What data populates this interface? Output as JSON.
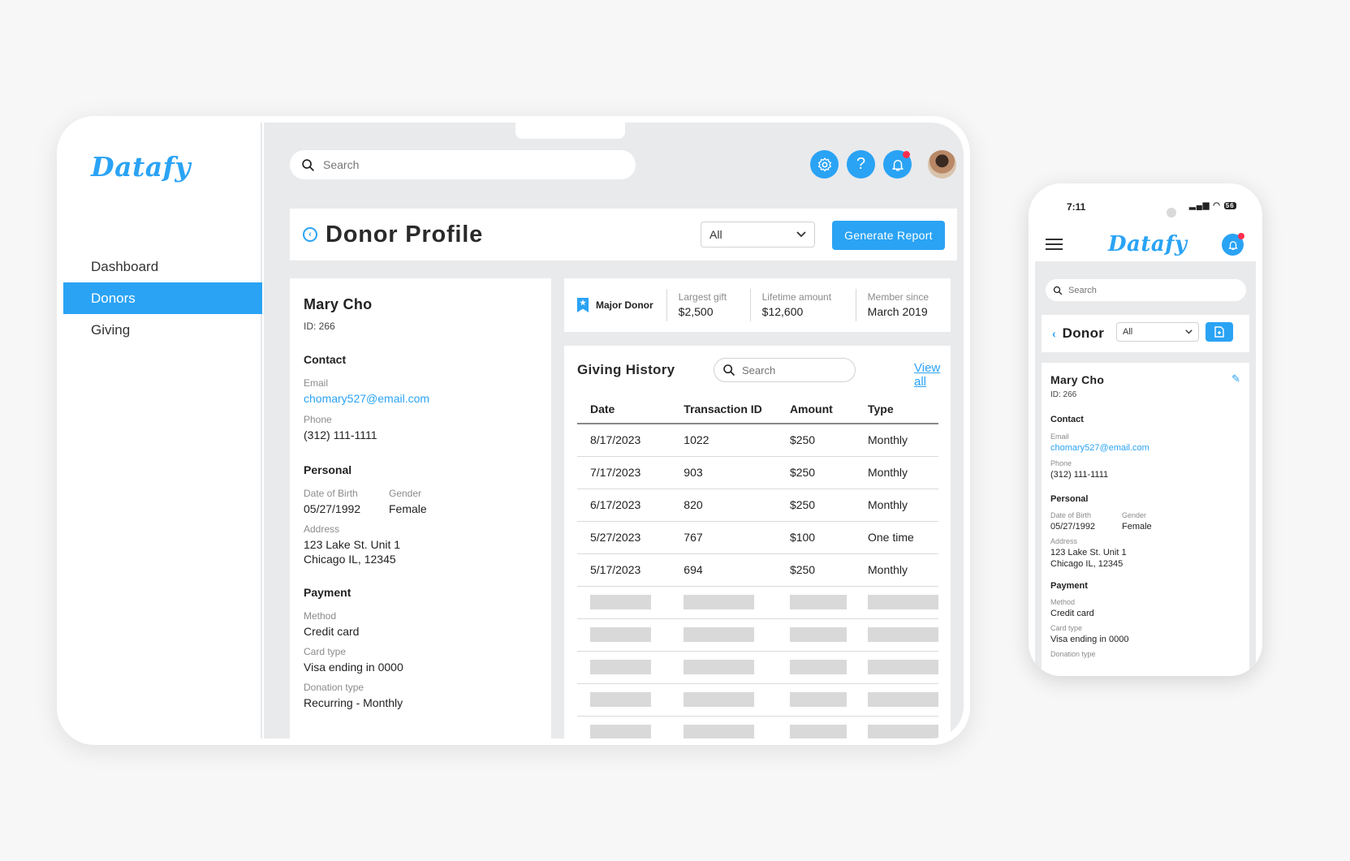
{
  "app": {
    "logo": "Datafy"
  },
  "colors": {
    "accent": "#2aa3f5",
    "notification": "#ff2e4c",
    "page_bg": "#e9eaec"
  },
  "sidebar": {
    "items": [
      {
        "label": "Dashboard"
      },
      {
        "label": "Donors",
        "active": true
      },
      {
        "label": "Giving"
      }
    ]
  },
  "topbar": {
    "search_placeholder": "Search",
    "icons": [
      "gear-icon",
      "help-icon",
      "bell-icon"
    ],
    "help_glyph": "?"
  },
  "header": {
    "title": "Donor Profile",
    "filter_value": "All",
    "report_button": "Generate Report"
  },
  "donor": {
    "name": "Mary Cho",
    "id": "ID: 266",
    "contact": {
      "title": "Contact",
      "email_label": "Email",
      "email": "chomary527@email.com",
      "phone_label": "Phone",
      "phone": "(312) 111-1111"
    },
    "personal": {
      "title": "Personal",
      "dob_label": "Date of Birth",
      "dob": "05/27/1992",
      "gender_label": "Gender",
      "gender": "Female",
      "address_label": "Address",
      "address_line1": "123 Lake St. Unit 1",
      "address_line2": "Chicago IL, 12345"
    },
    "payment": {
      "title": "Payment",
      "method_label": "Method",
      "method": "Credit card",
      "card_label": "Card type",
      "card": "Visa ending in 0000",
      "donation_label": "Donation type",
      "donation": "Recurring - Monthly"
    }
  },
  "stats": {
    "badge": "Major Donor",
    "items": [
      {
        "label": "Largest gift",
        "value": "$2,500"
      },
      {
        "label": "Lifetime amount",
        "value": "$12,600"
      },
      {
        "label": "Member since",
        "value": "March 2019"
      }
    ]
  },
  "giving_history": {
    "title": "Giving History",
    "search_placeholder": "Search",
    "view_all": "View all",
    "columns": [
      "Date",
      "Transaction ID",
      "Amount",
      "Type"
    ],
    "rows": [
      [
        "8/17/2023",
        "1022",
        "$250",
        "Monthly"
      ],
      [
        "7/17/2023",
        "903",
        "$250",
        "Monthly"
      ],
      [
        "6/17/2023",
        "820",
        "$250",
        "Monthly"
      ],
      [
        "5/27/2023",
        "767",
        "$100",
        "One time"
      ],
      [
        "5/17/2023",
        "694",
        "$250",
        "Monthly"
      ]
    ]
  },
  "mobile": {
    "time": "7:11",
    "battery": "56",
    "search_placeholder": "Search",
    "title": "Donor",
    "filter_value": "All",
    "donation_label_partial": "Donation type"
  }
}
